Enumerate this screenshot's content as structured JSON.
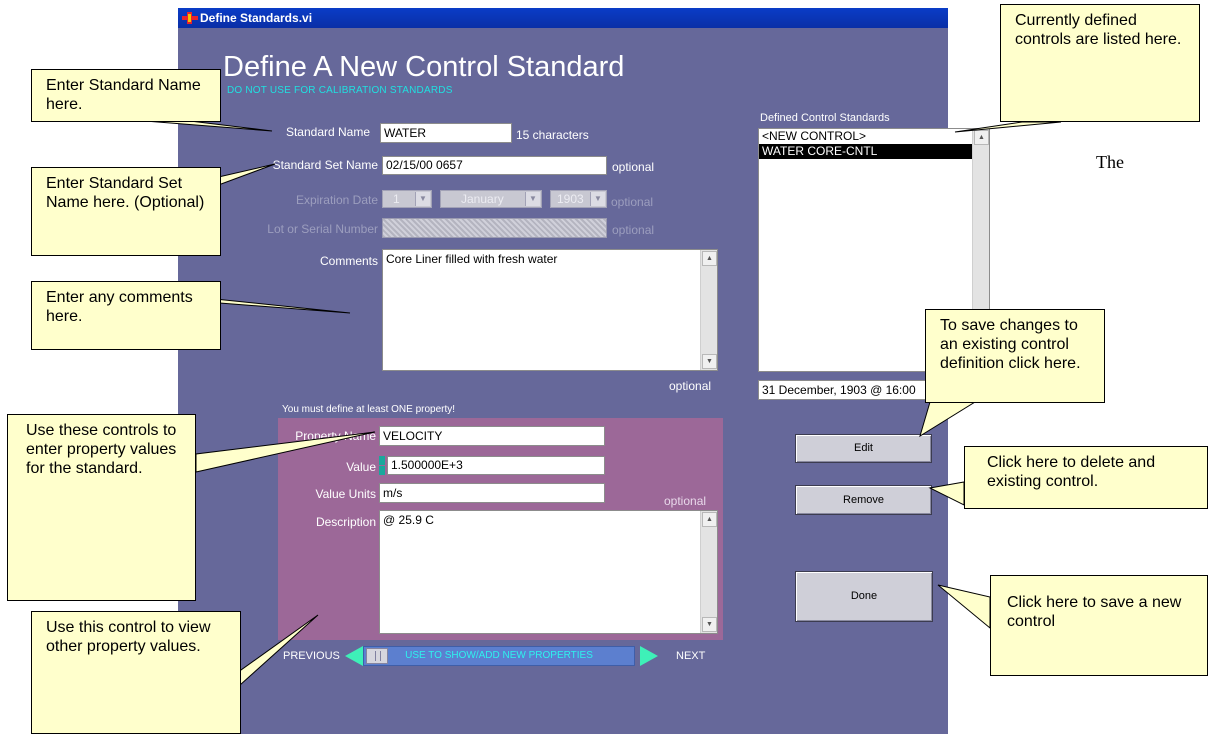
{
  "window": {
    "title": "Define Standards.vi"
  },
  "header": {
    "title": "Define A New Control Standard",
    "warning": "DO NOT USE FOR CALIBRATION STANDARDS"
  },
  "form": {
    "standard_name": {
      "label": "Standard Name",
      "value": "WATER",
      "note": "15 characters"
    },
    "set_name": {
      "label": "Standard Set Name",
      "value": "02/15/00 0657",
      "note": "optional"
    },
    "expiration": {
      "label": "Expiration Date",
      "day": "1",
      "month": "January",
      "year": "1903",
      "note": "optional"
    },
    "lot": {
      "label": "Lot or Serial Number",
      "note": "optional"
    },
    "comments": {
      "label": "Comments",
      "value": "Core Liner filled with fresh water",
      "note": "optional"
    }
  },
  "property": {
    "instruction": "You must define at least ONE property!",
    "name": {
      "label": "Property Name",
      "value": "VELOCITY"
    },
    "value": {
      "label": "Value",
      "value": "1.500000E+3"
    },
    "units": {
      "label": "Value Units",
      "value": "m/s",
      "note": "optional"
    },
    "description": {
      "label": "Description",
      "value": "@ 25.9 C"
    }
  },
  "navigation": {
    "previous": "PREVIOUS",
    "next": "NEXT",
    "slider_text": "USE TO SHOW/ADD NEW PROPERTIES",
    "position": 0
  },
  "defined": {
    "label": "Defined Control Standards",
    "items": [
      "<NEW CONTROL>",
      "WATER CORE-CNTL"
    ],
    "selected_index": 1,
    "timestamp": "31 December, 1903  @ 16:00"
  },
  "buttons": {
    "edit": "Edit",
    "remove": "Remove",
    "done": "Done"
  },
  "callouts": {
    "standard_name": "Enter Standard Name here.",
    "set_name": "Enter Standard Set Name here. (Optional)",
    "comments": "Enter any comments here.",
    "property_controls": "Use these controls to enter property values for the standard.",
    "slider": "Use this control to view other property values.",
    "defined_list": "Currently defined controls are listed here.",
    "edit": "To save changes to an existing control definition click here.",
    "remove": "Click here to delete and existing control.",
    "done": "Click here to save a new control"
  },
  "side_text": "The",
  "colors": {
    "panel": "#66689a",
    "property_panel": "#9c6898",
    "callout_fill": "#ffffcc",
    "title_bar": "#0a3cc7",
    "accent_cyan": "#20e0e0",
    "slider_track": "#5c7fcf"
  }
}
